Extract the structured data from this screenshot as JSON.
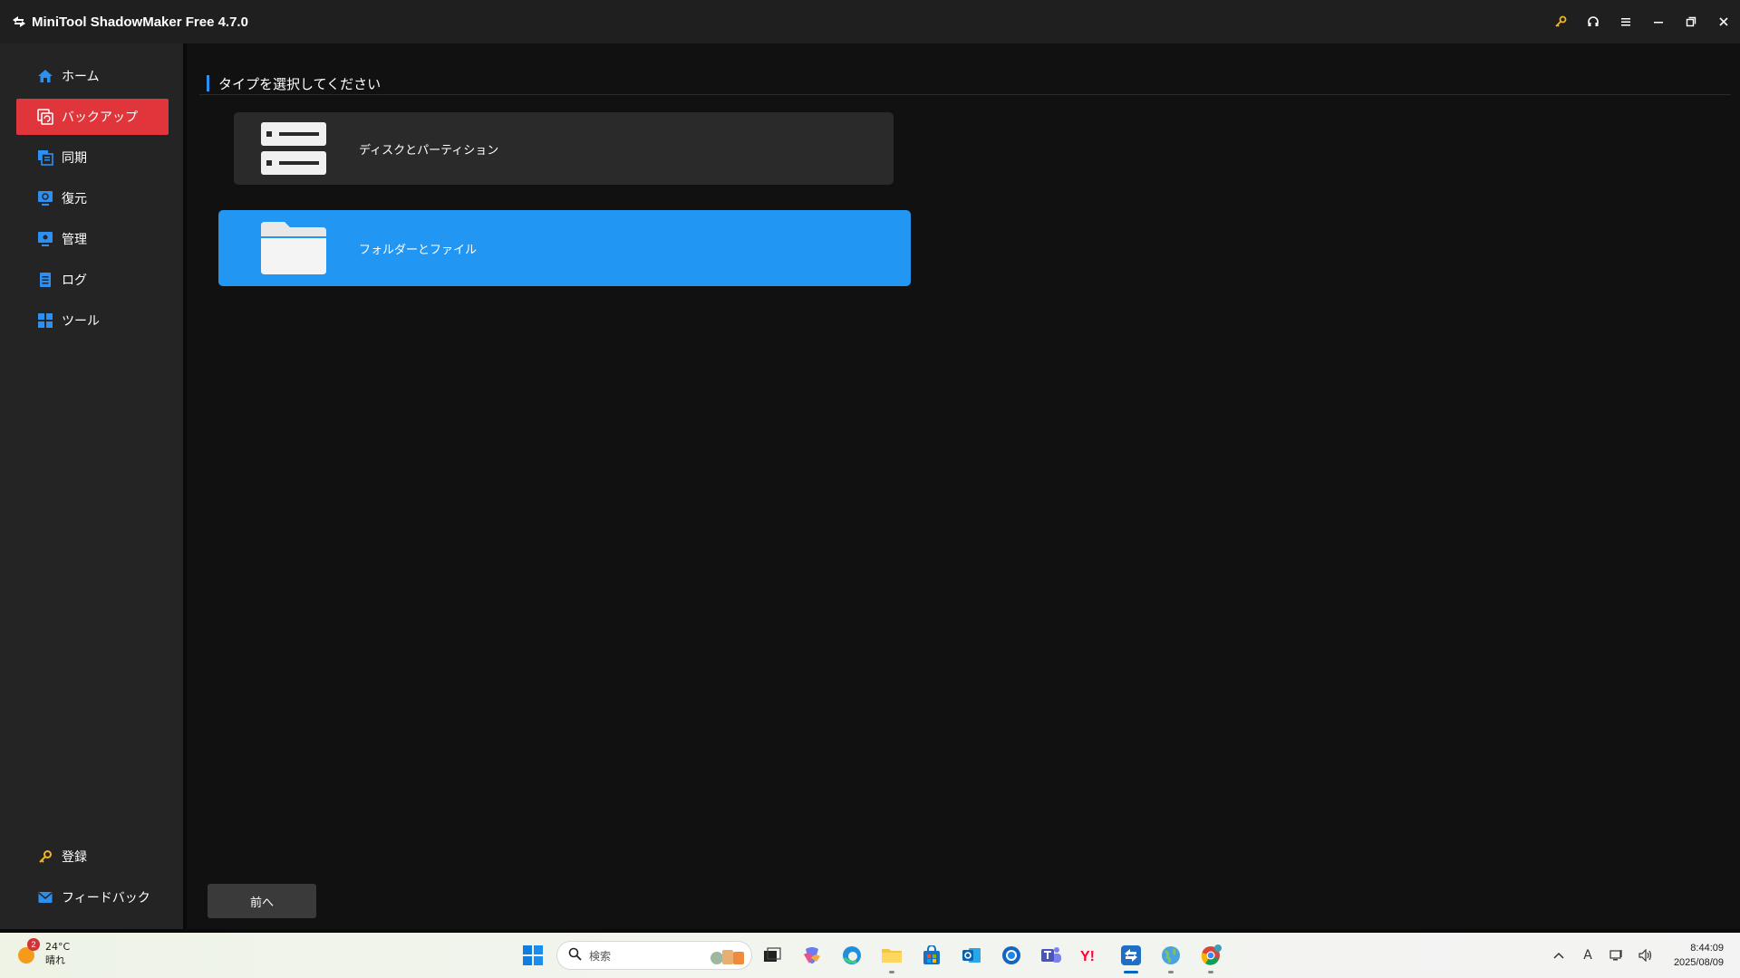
{
  "app": {
    "title": "MiniTool ShadowMaker Free 4.7.0"
  },
  "titlebar": {
    "buttons": [
      "key-icon",
      "headset-icon",
      "menu-icon",
      "minimize-icon",
      "restore-icon",
      "close-icon"
    ]
  },
  "sidebar": {
    "items": [
      {
        "label": "ホーム",
        "icon": "home-icon",
        "active": false
      },
      {
        "label": "バックアップ",
        "icon": "backup-icon",
        "active": true
      },
      {
        "label": "同期",
        "icon": "sync-icon",
        "active": false
      },
      {
        "label": "復元",
        "icon": "restore-icon",
        "active": false
      },
      {
        "label": "管理",
        "icon": "manage-icon",
        "active": false
      },
      {
        "label": "ログ",
        "icon": "log-icon",
        "active": false
      },
      {
        "label": "ツール",
        "icon": "tools-icon",
        "active": false
      }
    ],
    "bottom": [
      {
        "label": "登録",
        "icon": "key-icon"
      },
      {
        "label": "フィードバック",
        "icon": "mail-icon"
      }
    ]
  },
  "main": {
    "section_title": "タイプを選択してください",
    "cards": [
      {
        "label": "ディスクとパーティション",
        "icon": "disk-icon",
        "selected": false
      },
      {
        "label": "フォルダーとファイル",
        "icon": "folder-icon",
        "selected": true
      }
    ],
    "back_label": "前へ"
  },
  "colors": {
    "accent_red": "#e0363b",
    "accent_blue": "#2196f3",
    "background": "#111111",
    "sidebar": "#242424"
  },
  "taskbar": {
    "weather": {
      "badge": "2",
      "temp": "24°C",
      "condition": "晴れ"
    },
    "search_placeholder": "検索",
    "clock": {
      "time": "8:44:09",
      "date": "2025/08/09"
    },
    "ime": "A"
  }
}
